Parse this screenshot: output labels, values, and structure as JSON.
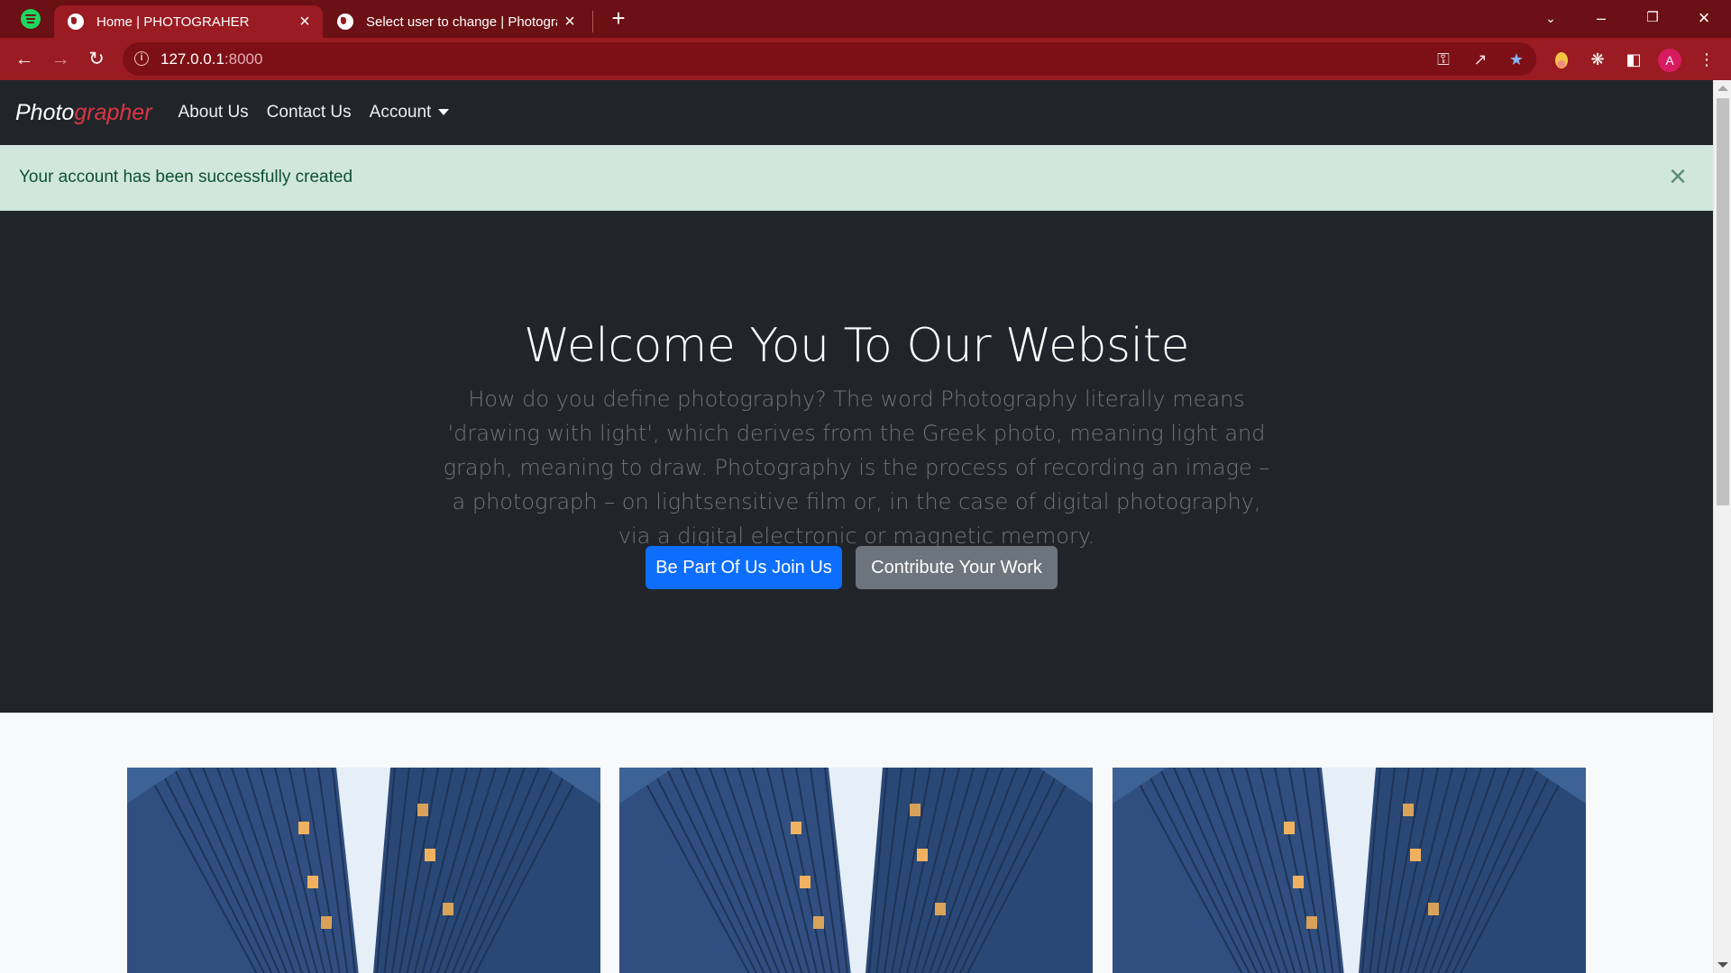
{
  "browser": {
    "tabs": [
      {
        "title": "Home | PHOTOGRAHER",
        "active": true
      },
      {
        "title": "Select user to change | Photographer",
        "active": false
      }
    ],
    "new_tab_symbol": "+",
    "url_host": "127.0.0.1",
    "url_port": ":8000",
    "avatar_letter": "A",
    "icons": [
      "back-arrow-icon",
      "forward-arrow-icon",
      "reload-icon",
      "info-icon",
      "key-icon",
      "share-icon",
      "star-icon",
      "extension-icon",
      "puzzle-icon",
      "sidepanel-icon",
      "menu-icon"
    ]
  },
  "navbar": {
    "brand_prefix": "Photo",
    "brand_suffix": "grapher",
    "links": [
      "About Us",
      "Contact Us",
      "Account"
    ]
  },
  "alert": {
    "message": "Your account has been successfully created"
  },
  "hero": {
    "title": "Welcome You To Our Website",
    "text": "How do you define photography? The word Photography literally means 'drawing with light', which derives from the Greek photo, meaning light and graph, meaning to draw. Photography is the process of recording an image – a photograph – on lightsensitive film or, in the case of digital photography, via a digital electronic or magnetic memory.",
    "primary_button": "Be Part Of Us Join Us",
    "secondary_button": "Contribute Your Work"
  },
  "colors": {
    "tabbar": "#6b1014",
    "toolbar": "#9a1b22",
    "navbar": "#212529",
    "alert_bg": "#d1e7dd",
    "primary": "#0d6efd",
    "secondary": "#6c757d",
    "brand_accent": "#dc3545"
  }
}
